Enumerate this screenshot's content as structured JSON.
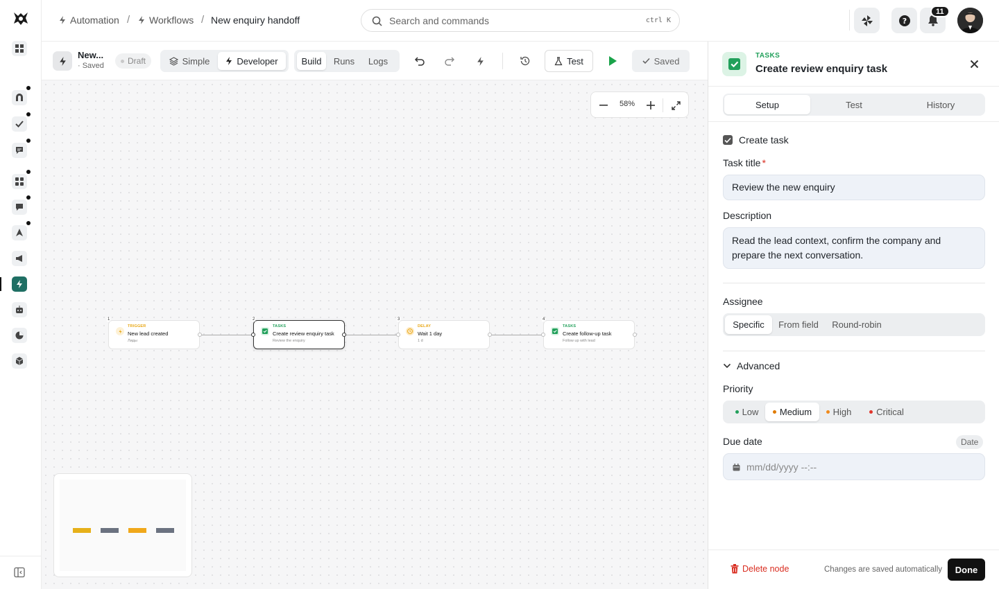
{
  "breadcrumb": {
    "items": [
      "Automation",
      "Workflows"
    ],
    "current": "New enquiry handoff"
  },
  "search": {
    "placeholder": "Search and commands",
    "shortcut": "ctrl K"
  },
  "topbar": {
    "notification_count": "11"
  },
  "toolbar": {
    "workflow_name": "New...",
    "workflow_status": "· Saved",
    "draft_label": "Draft",
    "mode_simple": "Simple",
    "mode_developer": "Developer",
    "tab_build": "Build",
    "tab_runs": "Runs",
    "tab_logs": "Logs",
    "test_label": "Test",
    "saved_label": "Saved"
  },
  "canvas": {
    "zoom": "58%",
    "nodes": [
      {
        "num": "1",
        "category": "TRIGGER",
        "title": "New lead created",
        "subtitle": "Лиды",
        "color": "#e8a715"
      },
      {
        "num": "2",
        "category": "TASKS",
        "title": "Create review enquiry task",
        "subtitle": "Review the enquiry",
        "color": "#22a05b"
      },
      {
        "num": "3",
        "category": "DELAY",
        "title": "Wait 1 day",
        "subtitle": "1 d",
        "color": "#e8a715"
      },
      {
        "num": "4",
        "category": "TASKS",
        "title": "Create follow-up task",
        "subtitle": "Follow up with lead",
        "color": "#22a05b"
      }
    ],
    "minimap_colors": [
      "#e6b019",
      "#6b7280",
      "#f0a81b",
      "#6b7280"
    ]
  },
  "panel": {
    "category": "TASKS",
    "title": "Create review enquiry task",
    "tabs": [
      "Setup",
      "Test",
      "History"
    ],
    "active_tab": "Setup",
    "create_task_label": "Create task",
    "create_task_checked": true,
    "task_title_label": "Task title",
    "task_title_required": "*",
    "task_title_value": "Review the new enquiry",
    "description_label": "Description",
    "description_value": "Read the lead context, confirm the company and prepare the next conversation.",
    "assignee_label": "Assignee",
    "assignee_options": [
      "Specific",
      "From field",
      "Round-robin"
    ],
    "assignee_selected": "Specific",
    "advanced_label": "Advanced",
    "priority_label": "Priority",
    "priority_options": [
      {
        "label": "Low",
        "color": "#22a05b"
      },
      {
        "label": "Medium",
        "color": "#e07b00"
      },
      {
        "label": "High",
        "color": "#f08a1c"
      },
      {
        "label": "Critical",
        "color": "#e0352b"
      }
    ],
    "priority_selected": "Medium",
    "due_date_label": "Due date",
    "due_date_type": "Date",
    "due_date_placeholder": "mm/dd/yyyy --:--",
    "delete_label": "Delete node",
    "autosave_note": "Changes are saved automatically",
    "done_label": "Done"
  },
  "colors": {
    "accent": "#1f6f64",
    "success": "#22a05b",
    "danger": "#d92d20",
    "play": "#1aa34a"
  }
}
